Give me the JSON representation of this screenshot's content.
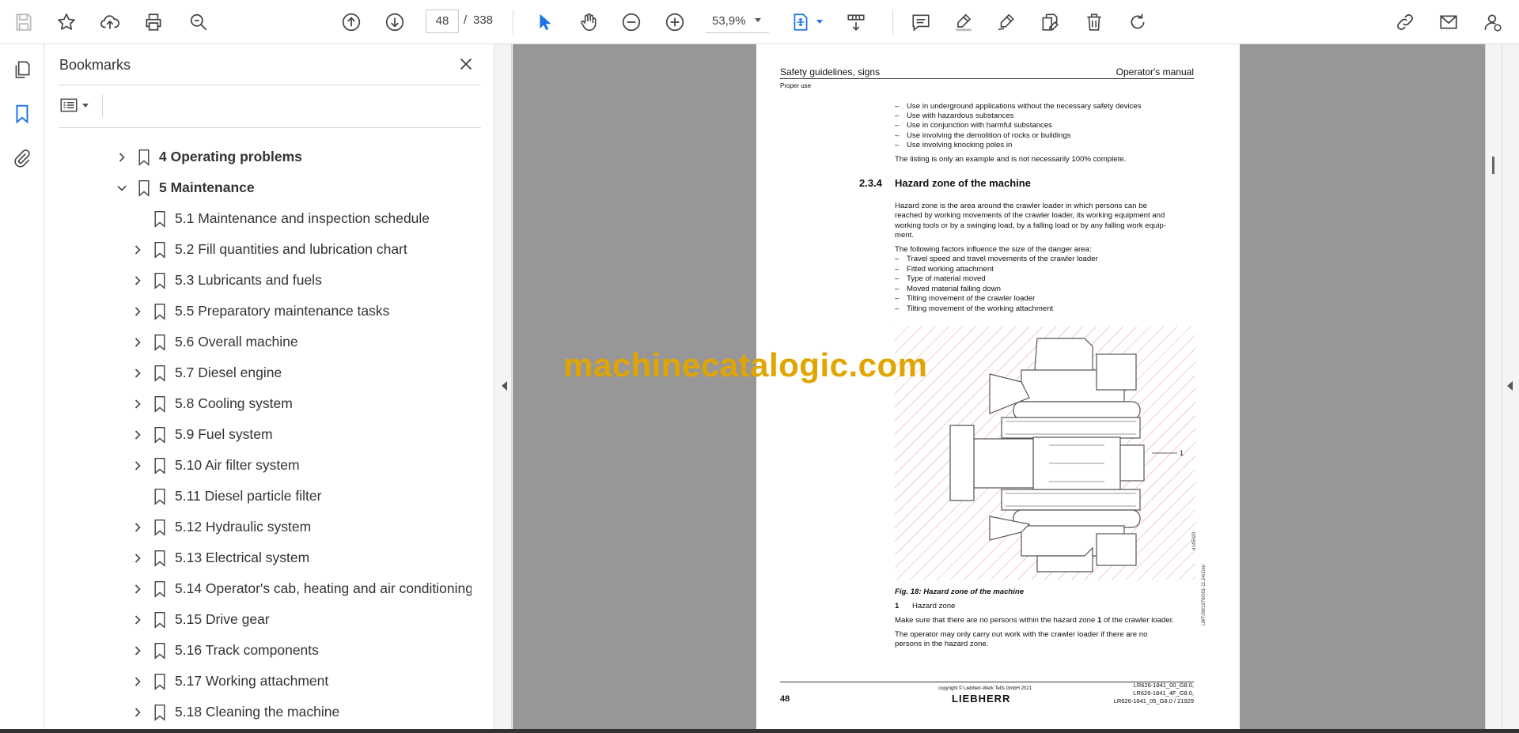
{
  "toolbar": {
    "page_current": "48",
    "page_separator": "/",
    "page_total": "338",
    "zoom": "53,9%"
  },
  "bookmarks": {
    "title": "Bookmarks",
    "items": [
      {
        "label": "4 Operating problems",
        "level": 0,
        "expandable": true,
        "expanded": false
      },
      {
        "label": "5 Maintenance",
        "level": 0,
        "expandable": true,
        "expanded": true
      },
      {
        "label": "5.1 Maintenance and inspection schedule",
        "level": 1,
        "expandable": false
      },
      {
        "label": "5.2 Fill quantities and lubrication chart",
        "level": 1,
        "expandable": true
      },
      {
        "label": "5.3 Lubricants and fuels",
        "level": 1,
        "expandable": true
      },
      {
        "label": "5.5 Preparatory maintenance tasks",
        "level": 1,
        "expandable": true
      },
      {
        "label": "5.6 Overall machine",
        "level": 1,
        "expandable": true
      },
      {
        "label": "5.7 Diesel engine",
        "level": 1,
        "expandable": true
      },
      {
        "label": "5.8 Cooling system",
        "level": 1,
        "expandable": true
      },
      {
        "label": "5.9 Fuel system",
        "level": 1,
        "expandable": true
      },
      {
        "label": "5.10 Air filter system",
        "level": 1,
        "expandable": true
      },
      {
        "label": "5.11 Diesel particle filter",
        "level": 1,
        "expandable": false
      },
      {
        "label": "5.12 Hydraulic system",
        "level": 1,
        "expandable": true
      },
      {
        "label": "5.13 Electrical system",
        "level": 1,
        "expandable": true
      },
      {
        "label": "5.14 Operator's cab, heating and air conditioning",
        "level": 1,
        "expandable": true
      },
      {
        "label": "5.15 Drive gear",
        "level": 1,
        "expandable": true
      },
      {
        "label": "5.16 Track components",
        "level": 1,
        "expandable": true
      },
      {
        "label": "5.17 Working attachment",
        "level": 1,
        "expandable": true
      },
      {
        "label": "5.18 Cleaning the machine",
        "level": 1,
        "expandable": true
      }
    ]
  },
  "document": {
    "header_left": "Safety guidelines, signs",
    "header_right": "Operator's manual",
    "header_sub": "Proper use",
    "list_top": [
      "Use in underground applications without the necessary safety devices",
      "Use with hazardous substances",
      "Use in conjunction with harmful substances",
      "Use involving the demolition of rocks or buildings",
      "Use involving knocking poles in"
    ],
    "listing_note": "The listing is only an example and is not necessarily 100% complete.",
    "section_number": "2.3.4",
    "section_title": "Hazard zone of the machine",
    "para1": [
      "Hazard zone is the area around the crawler loader in which persons can be",
      "reached by working movements of the crawler loader, its working equipment and",
      "working tools or by a swinging load, by a falling load or by any falling work equip-",
      "ment."
    ],
    "factors_intro": "The following factors influence the size of the danger area:",
    "factors": [
      "Travel speed and travel movements of the crawler loader",
      "Fitted working attachment",
      "Type of material moved",
      "Moved material falling down",
      "Tilting movement of the crawler loader",
      "Tilting movement of the working attachment"
    ],
    "figure_callout": "1",
    "figure_side_code": "4145020",
    "figure_side_code2": "LWT/26/1976/001-11.24/2/en",
    "figure_caption": "Fig. 18: Hazard zone of the machine",
    "legend_number": "1",
    "legend_text": "Hazard zone",
    "para2_a": "Make sure that there are no persons within the hazard zone ",
    "para2_b": "1",
    "para2_c": " of the crawler loader.",
    "para3": [
      "The operator may only carry out work with the crawler loader if there are no",
      "persons in the hazard zone."
    ],
    "footer_page": "48",
    "footer_copyright": "copyright © Liebherr-Werk Telfs GmbH 2021",
    "footer_logo": "LIEBHERR",
    "footer_ref": [
      "LR626-1841_00_G8.0,",
      "LR626-1841_4F_G8.0,",
      "LR626-1841_05_G8.0 / 21929"
    ]
  },
  "watermark": "machinecatalogic.com",
  "colors": {
    "accent": "#1a73e8",
    "watermark": "#e0a500",
    "viewport_bg": "#979797",
    "hatch": "#e89a9a"
  }
}
